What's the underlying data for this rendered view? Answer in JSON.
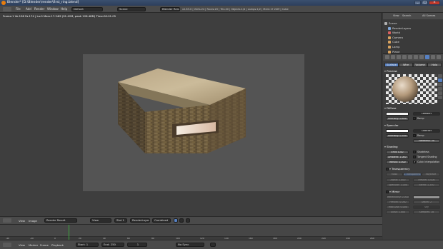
{
  "window": {
    "title": "Blender* [D:\\Blender\\render\\first_ring.blend]",
    "buttons": [
      "_",
      "□",
      "×"
    ]
  },
  "menubar": {
    "items": [
      "File",
      "Add",
      "Render",
      "Window",
      "Help"
    ],
    "screen_layout": "Default",
    "scene": "Scene",
    "render_engine": "Blender Render",
    "stats": "v2.63.0 | Verts:24 | Faces:20 | Tris:40 | Objects:1/4 | Lamps:1/2 | Mem:17.24M | Cube"
  },
  "viewport": {
    "info": "Frame:1 Ve:196 Fa:174 | La:0 Mem:17.24M (91.42M, peak 126.48M) Time:00:01.05"
  },
  "image_header": {
    "items": [
      "View",
      "Image"
    ],
    "image_name": "Render Result",
    "view_mode": "View",
    "slot": "Slot 1",
    "layer": "RenderLayer",
    "pass": "Combined"
  },
  "timeline": {
    "ticks": [
      "-40",
      "-20",
      "0",
      "20",
      "40",
      "60",
      "80",
      "100",
      "120",
      "140",
      "160",
      "180",
      "200",
      "220",
      "240",
      "260"
    ],
    "current_frame": 1
  },
  "bottombar": {
    "items": [
      "View",
      "Marker",
      "Frame",
      "Playback"
    ],
    "start": "Start: 1",
    "end": "End: 250",
    "frame": "1",
    "sync": "No Sync"
  },
  "outliner": {
    "header_items": [
      "View",
      "Search",
      "All Scenes"
    ],
    "rows": [
      {
        "label": "Scene",
        "color": "#b0b0b0"
      },
      {
        "label": "RenderLayers",
        "color": "#7fa7d9"
      },
      {
        "label": "World",
        "color": "#d95f5f"
      },
      {
        "label": "Camera",
        "color": "#d9a35f"
      },
      {
        "label": "Cube",
        "color": "#d9a35f"
      },
      {
        "label": "Lamp",
        "color": "#d9a35f"
      },
      {
        "label": "Plane",
        "color": "#d9a35f"
      }
    ]
  },
  "properties": {
    "material_tabs": [
      "Surface",
      "Wire",
      "Volume",
      "Halo"
    ],
    "preview_label": "Preview",
    "diffuse": {
      "label": "Diffuse",
      "shader": "Lambert",
      "intensity": "Intensity: 0.800",
      "ramp": "Ramp",
      "color": "#f2f2f2"
    },
    "specular": {
      "label": "Specular",
      "shader": "CookTorr",
      "intensity": "Intensity: 0.500",
      "hardness": "Hardness: 50",
      "ramp": "Ramp",
      "color": "#ffffff"
    },
    "shading": {
      "label": "Shading",
      "emit": "Emit: 0.00",
      "ambient": "Ambient: 1.000",
      "translucency": "Translu: 0.000",
      "shadeless": "Shadeless",
      "tangent": "Tangent Shading",
      "cubic": "Cubic Interpolation"
    },
    "transparency": {
      "label": "Transparency",
      "modes": [
        "Mask",
        "Z Transparency",
        "Raytrace"
      ],
      "alpha": "Alpha: 1.000",
      "fresnel": "Fresnel: 0.000",
      "specular": "Specular: 1.000",
      "blend": "Blend: 1.250"
    },
    "mirror": {
      "label": "Mirror",
      "reflectivity": "Reflectivity: 0.000",
      "fresnel": "Fresnel: 0.000",
      "depth": "Depth: 2",
      "max_dist": "Max Dist: 0.000",
      "gloss": "Gloss: 1.000",
      "fade_to": "Sky",
      "samples": "Samples: 18"
    }
  },
  "colors": {
    "accent": "#5680c2",
    "blender_orange": "#e87d0d",
    "playhead": "#3fa83f"
  }
}
